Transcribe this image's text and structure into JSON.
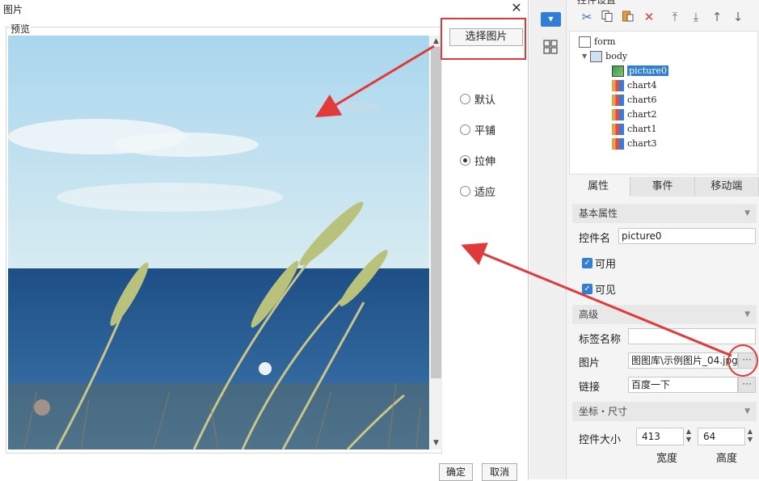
{
  "dialog": {
    "title": "图片",
    "preview_label": "预览",
    "select_button": "选择图片",
    "options": [
      {
        "label": "默认",
        "selected": false
      },
      {
        "label": "平铺",
        "selected": false
      },
      {
        "label": "拉伸",
        "selected": true
      },
      {
        "label": "适应",
        "selected": false
      }
    ],
    "ok_button": "确定",
    "cancel_button": "取消"
  },
  "panel": {
    "title": "控件设置",
    "toolbar": [
      "cut-icon",
      "copy-icon",
      "paste-icon",
      "delete-icon",
      "move-top-icon",
      "move-bottom-icon",
      "move-up-icon",
      "move-down-icon"
    ],
    "tree": {
      "root": "form",
      "body": "body",
      "items": [
        "picture0",
        "chart4",
        "chart6",
        "chart2",
        "chart1",
        "chart3"
      ],
      "selected": "picture0"
    },
    "tabs": [
      "属性",
      "事件",
      "移动端"
    ],
    "sections": {
      "basic": "基本属性",
      "advanced": "高级",
      "coords": "坐标・尺寸"
    },
    "props": {
      "name_label": "控件名",
      "name_value": "picture0",
      "enabled_label": "可用",
      "visible_label": "可见",
      "tag_label": "标签名称",
      "tag_value": "",
      "image_label": "图片",
      "image_value": "图图库\\示例图片_04.jpg",
      "link_label": "链接",
      "link_value": "百度一下",
      "size_label": "控件大小",
      "width_value": "413",
      "height_value": "64",
      "width_caption": "宽度",
      "height_caption": "高度"
    }
  },
  "colors": {
    "accent": "#2f7fd8",
    "annotation": "#e03a3a"
  }
}
